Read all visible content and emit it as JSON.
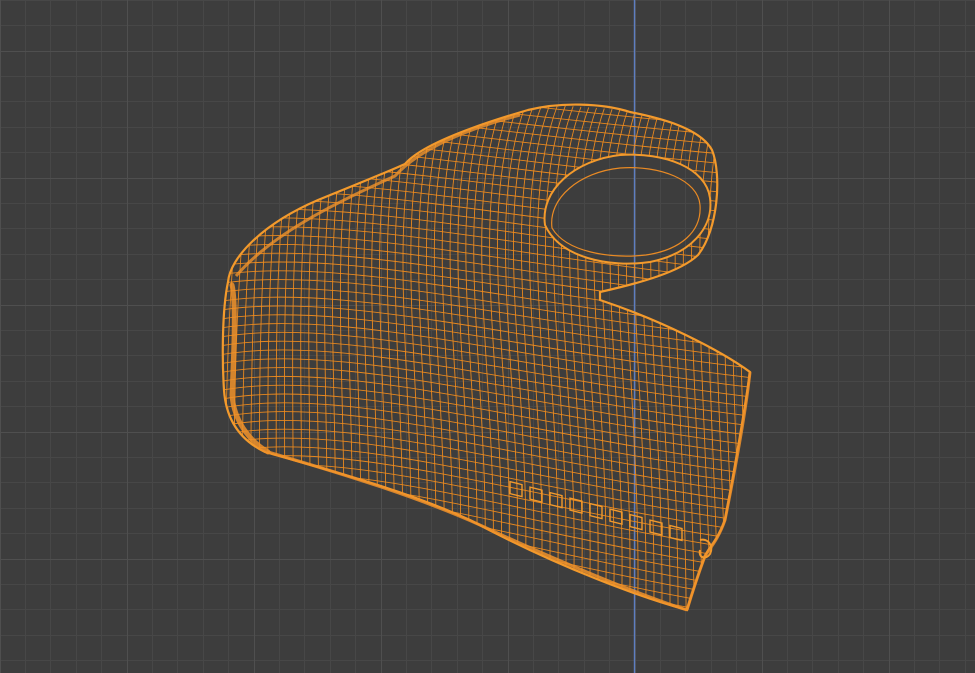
{
  "viewport": {
    "mode": "wireframe",
    "selected_object": true,
    "colors": {
      "background": "#3d3d3d",
      "grid_minor": "#474747",
      "grid_major": "#4f4f4f",
      "axis_z": "#5d7ec2",
      "wire_selected": "#f08c1e"
    }
  }
}
